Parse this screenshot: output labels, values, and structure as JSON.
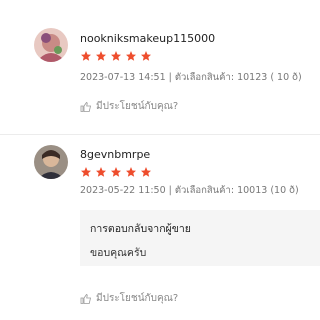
{
  "reviews": [
    {
      "username": "nookniksmakeup115000",
      "rating": 5,
      "meta": "2023-07-13 14:51 | ตัวเลือกสินค้า: 10123 ( 10 ð)",
      "helpful_label": "มีประโยชน์กับคุณ?"
    },
    {
      "username": "8gevnbmrpe",
      "rating": 5,
      "meta": "2023-05-22 11:50 | ตัวเลือกสินค้า: 10013 (10 ð)",
      "seller_reply": {
        "title": "การตอบกลับจากผู้ขาย",
        "text": "ขอบคุณครับ"
      },
      "helpful_label": "มีประโยชน์กับคุณ?"
    }
  ],
  "colors": {
    "star": "#ee4d2d",
    "reply_bg": "#f5f5f5",
    "meta_text": "#777777"
  },
  "icons": {
    "star": "star-icon",
    "thumb": "thumbs-up-icon"
  }
}
